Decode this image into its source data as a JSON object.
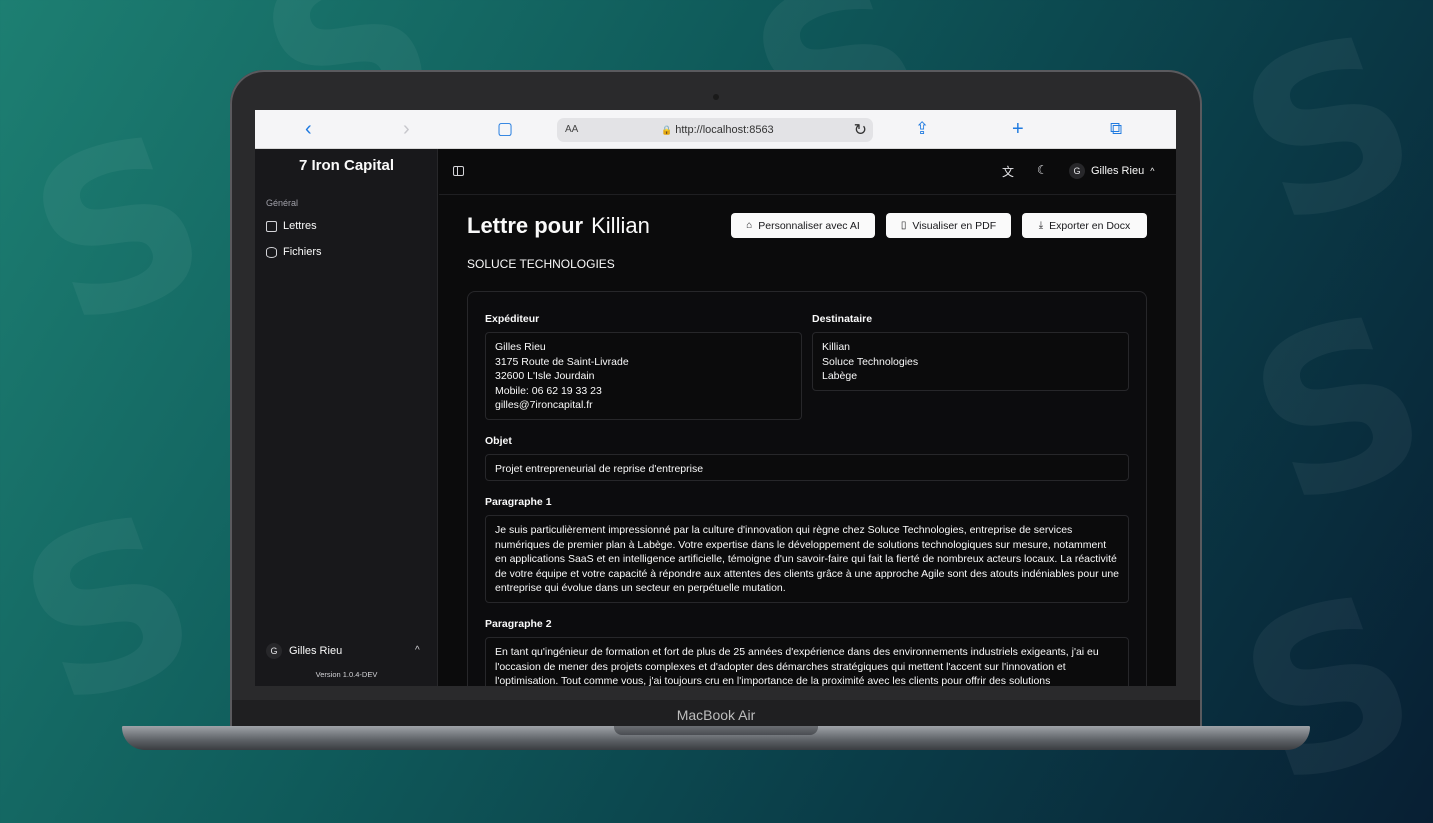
{
  "device": {
    "label": "MacBook Air"
  },
  "browser": {
    "address_prefix": "AA",
    "url": "http://localhost:8563"
  },
  "sidebar": {
    "brand": "7 Iron Capital",
    "section": "Général",
    "items": [
      {
        "label": "Lettres",
        "icon": "letters-icon"
      },
      {
        "label": "Fichiers",
        "icon": "database-icon"
      }
    ],
    "user": {
      "initial": "G",
      "name": "Gilles Rieu"
    },
    "version": "Version 1.0.4-DEV"
  },
  "topbar": {
    "user": {
      "initial": "G",
      "name": "Gilles Rieu"
    }
  },
  "main": {
    "title_prefix": "Lettre pour",
    "title_name": "Killian",
    "company": "SOLUCE TECHNOLOGIES",
    "buttons": {
      "personalize": "Personnaliser avec AI",
      "pdf": "Visualiser en PDF",
      "docx": "Exporter en Docx"
    },
    "form": {
      "sender_label": "Expéditeur",
      "sender_value": "Gilles Rieu\n3175 Route de Saint-Livrade\n32600 L'Isle Jourdain\nMobile: 06 62 19 33 23\ngilles@7ironcapital.fr",
      "recipient_label": "Destinataire",
      "recipient_value": "Killian\nSoluce Technologies\nLabège",
      "subject_label": "Objet",
      "subject_value": "Projet entrepreneurial de reprise d'entreprise",
      "paragraph1_label": "Paragraphe 1",
      "paragraph1_value": "Je suis particulièrement impressionné par la culture d'innovation qui règne chez Soluce Technologies, entreprise de services numériques de premier plan à Labège. Votre expertise dans le développement de solutions technologiques sur mesure, notamment en applications SaaS et en intelligence artificielle, témoigne d'un savoir-faire qui fait la fierté de nombreux acteurs locaux. La réactivité de votre équipe et votre capacité à répondre aux attentes des clients grâce à une approche Agile sont des atouts indéniables pour une entreprise qui évolue dans un secteur en perpétuelle mutation.",
      "paragraph2_label": "Paragraphe 2",
      "paragraph2_value": "En tant qu'ingénieur de formation et fort de plus de 25 années d'expérience dans des environnements industriels exigeants, j'ai eu l'occasion de mener des projets complexes et d'adopter des démarches stratégiques qui mettent l'accent sur l'innovation et l'optimisation. Tout comme vous, j'ai toujours cru en l'importance de la proximité avec les clients pour offrir des solutions"
    }
  }
}
